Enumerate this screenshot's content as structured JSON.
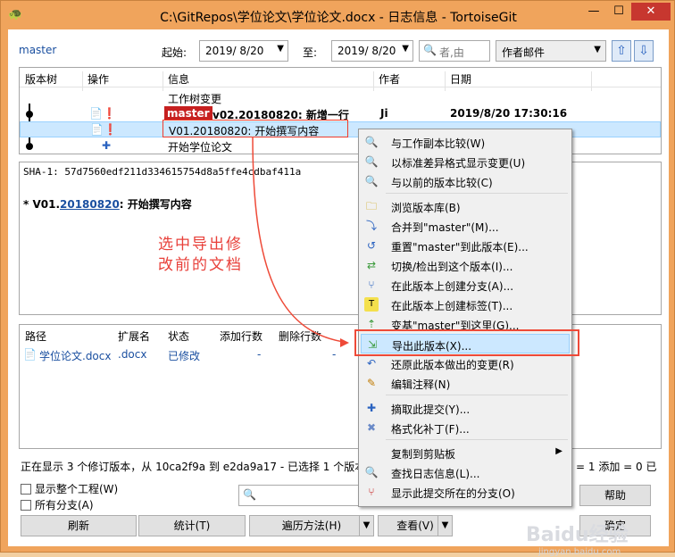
{
  "window": {
    "title": "C:\\GitRepos\\学位论文\\学位论文.docx - 日志信息 - TortoiseGit",
    "min": "—",
    "max": "☐",
    "close": "✕"
  },
  "toolbar": {
    "branch": "master",
    "from_label": "起始:",
    "from_date": "2019/ 8/20",
    "to_label": "至:",
    "to_date": "2019/ 8/20",
    "filter_placeholder": "者,由",
    "filter_field": "作者邮件",
    "up": "⇧",
    "down": "⇩"
  },
  "log": {
    "columns": [
      "版本树",
      "操作",
      "信息",
      "作者",
      "日期"
    ],
    "rows": [
      {
        "message": "工作树变更",
        "author": "",
        "date": ""
      },
      {
        "tag": "master",
        "message": "v02.20180820: 新增一行",
        "author": "Ji",
        "date": "2019/8/20 17:30:16"
      },
      {
        "message": "V01.20180820: 开始撰写内容",
        "author": "",
        "date": ""
      },
      {
        "message": "开始学位论文",
        "author": "",
        "date": ""
      }
    ]
  },
  "details": {
    "sha": "SHA-1: 57d7560edf211d334615754d8a5ffe4cdbaf411a",
    "msg_prefix": "* V01.",
    "msg_link": "20180820",
    "msg_suffix": ": 开始撰写内容"
  },
  "annotation": {
    "line1": "选中导出修",
    "line2": "改前的文档"
  },
  "files": {
    "columns": [
      "路径",
      "扩展名",
      "状态",
      "添加行数",
      "删除行数"
    ],
    "rows": [
      {
        "path": "学位论文.docx",
        "ext": ".docx",
        "status": "已修改",
        "added": "-",
        "deleted": "-"
      }
    ]
  },
  "status": {
    "text": "正在显示 3 个修订版本，从 10ca2f9a 到 e2da9a17 - 已选择 1 个版本，",
    "right": "= 1 添加 = 0 已"
  },
  "options": {
    "show_whole_project": "显示整个工程(W)",
    "all_branches": "所有分支(A)"
  },
  "buttons": {
    "refresh": "刷新",
    "stats": "统计(T)",
    "walk": "遍历方法(H)",
    "view": "查看(V)",
    "help": "帮助",
    "ok": "确定"
  },
  "context_menu": {
    "items": [
      "与工作副本比较(W)",
      "以标准差异格式显示变更(U)",
      "与以前的版本比较(C)",
      "浏览版本库(B)",
      "合并到\"master\"(M)...",
      "重置\"master\"到此版本(E)...",
      "切换/检出到这个版本(I)...",
      "在此版本上创建分支(A)...",
      "在此版本上创建标签(T)...",
      "变基\"master\"到这里(G)...",
      "导出此版本(X)...",
      "还原此版本做出的变更(R)",
      "编辑注释(N)",
      "摘取此提交(Y)...",
      "格式化补丁(F)...",
      "复制到剪贴板",
      "查找日志信息(L)...",
      "显示此提交所在的分支(O)"
    ]
  },
  "watermark": {
    "text": "Baidu经验",
    "sub": "jingyan.baidu.com"
  }
}
